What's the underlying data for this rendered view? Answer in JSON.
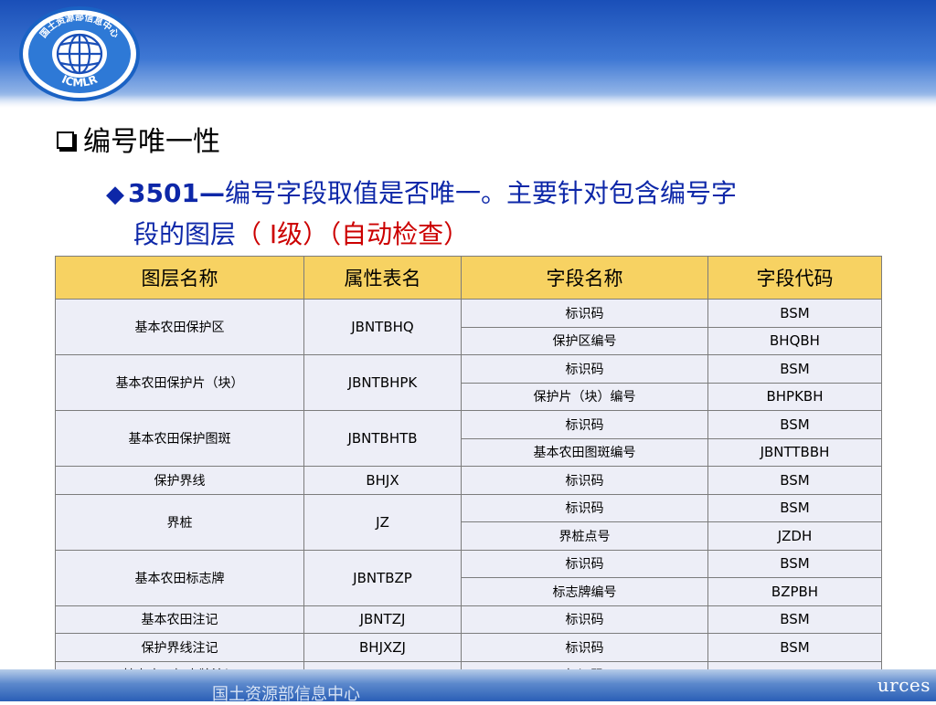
{
  "logo": {
    "top_text": "国土资源部信息中心",
    "bottom_text": "ICMLR"
  },
  "heading": {
    "bullet_icon": "checkbox-square-icon",
    "text": "编号唯一性"
  },
  "subheading": {
    "bullet_icon": "diamond-icon",
    "number": "3501",
    "dash": "—",
    "text_line1": "编号字段取值是否唯一。主要针对包含编号字",
    "text_line2_start": "段的图层",
    "level": "（ Ⅰ级）（自动检查）"
  },
  "table": {
    "headers": [
      "图层名称",
      "属性表名",
      "字段名称",
      "字段代码"
    ],
    "groups": [
      {
        "layer": "基本农田保护区",
        "table": "JBNTBHQ",
        "fields": [
          {
            "name": "标识码",
            "code": "BSM"
          },
          {
            "name": "保护区编号",
            "code": "BHQBH"
          }
        ]
      },
      {
        "layer": "基本农田保护片（块）",
        "table": "JBNTBHPK",
        "fields": [
          {
            "name": "标识码",
            "code": "BSM"
          },
          {
            "name": "保护片（块）编号",
            "code": "BHPKBH"
          }
        ]
      },
      {
        "layer": "基本农田保护图斑",
        "table": "JBNTBHTB",
        "fields": [
          {
            "name": "标识码",
            "code": "BSM"
          },
          {
            "name": "基本农田图斑编号",
            "code": "JBNTTBBH"
          }
        ]
      },
      {
        "layer": "保护界线",
        "table": "BHJX",
        "fields": [
          {
            "name": "标识码",
            "code": "BSM"
          }
        ]
      },
      {
        "layer": "界桩",
        "table": "JZ",
        "fields": [
          {
            "name": "标识码",
            "code": "BSM"
          },
          {
            "name": "界桩点号",
            "code": "JZDH"
          }
        ]
      },
      {
        "layer": "基本农田标志牌",
        "table": "JBNTBZP",
        "fields": [
          {
            "name": "标识码",
            "code": "BSM"
          },
          {
            "name": "标志牌编号",
            "code": "BZPBH"
          }
        ]
      },
      {
        "layer": "基本农田注记",
        "table": "JBNTZJ",
        "fields": [
          {
            "name": "标识码",
            "code": "BSM"
          }
        ]
      },
      {
        "layer": "保护界线注记",
        "table": "BHJXZJ",
        "fields": [
          {
            "name": "标识码",
            "code": "BSM"
          }
        ]
      },
      {
        "layer": "基本农田标志牌注记",
        "table": "JBNTBZPZJ",
        "fields": [
          {
            "name": "标识码",
            "code": "BSM"
          }
        ]
      }
    ]
  },
  "footer": {
    "left_text": "国土资源部信息中心",
    "right_text": "urces"
  },
  "colors": {
    "header_blue": "#1a4fb8",
    "table_header": "#f7d262",
    "table_body": "#edeef7",
    "accent_blue": "#0d27a8",
    "accent_red": "#cc0000"
  }
}
